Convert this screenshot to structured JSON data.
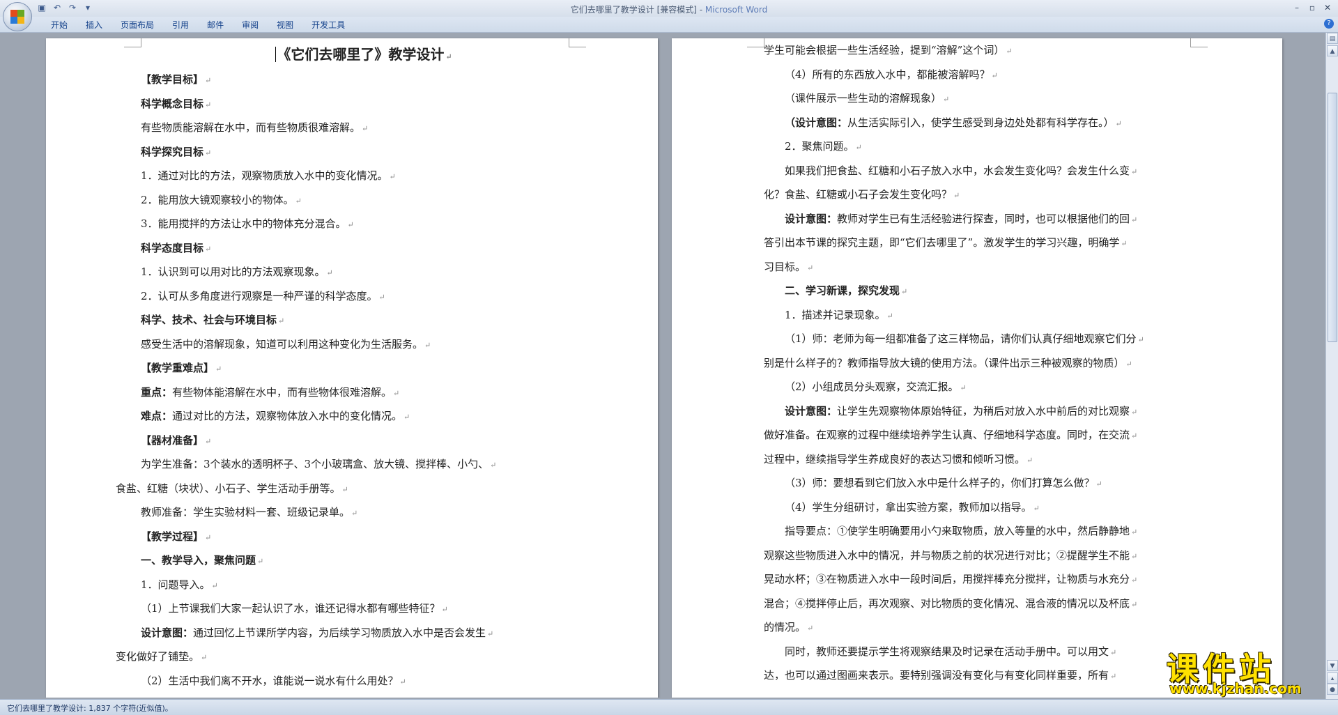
{
  "window": {
    "title": "它们去哪里了教学设计 [兼容模式] - ",
    "app": "Microsoft Word"
  },
  "ribbon": {
    "tabs": [
      "开始",
      "插入",
      "页面布局",
      "引用",
      "邮件",
      "审阅",
      "视图",
      "开发工具"
    ]
  },
  "status": {
    "text": "它们去哪里了教学设计: 1,837 个字符(近似值)。"
  },
  "watermark": {
    "big": "课件站",
    "small": "www.kjzhan.com"
  },
  "left_page": {
    "title": "《它们去哪里了》教学设计",
    "lines": [
      {
        "t": "【教学目标】",
        "b": true
      },
      {
        "t": "科学概念目标",
        "b": true
      },
      {
        "t": "有些物质能溶解在水中，而有些物质很难溶解。"
      },
      {
        "t": "科学探究目标",
        "b": true
      },
      {
        "t": "1．通过对比的方法，观察物质放入水中的变化情况。"
      },
      {
        "t": "2．能用放大镜观察较小的物体。"
      },
      {
        "t": "3．能用搅拌的方法让水中的物体充分混合。"
      },
      {
        "t": "科学态度目标",
        "b": true
      },
      {
        "t": "1．认识到可以用对比的方法观察现象。"
      },
      {
        "t": "2．认可从多角度进行观察是一种严谨的科学态度。"
      },
      {
        "t": "科学、技术、社会与环境目标",
        "b": true
      },
      {
        "t": "感受生活中的溶解现象，知道可以利用这种变化为生活服务。"
      },
      {
        "t": "【教学重难点】",
        "b": true
      },
      {
        "lead": "重点：",
        "t": "有些物体能溶解在水中，而有些物体很难溶解。"
      },
      {
        "lead": "难点：",
        "t": "通过对比的方法，观察物体放入水中的变化情况。"
      },
      {
        "t": "【器材准备】",
        "b": true
      },
      {
        "t": "为学生准备：3个装水的透明杯子、3个小玻璃盒、放大镜、搅拌棒、小勺、"
      },
      {
        "t": "食盐、红糖（块状）、小石子、学生活动手册等。",
        "hang": true
      },
      {
        "t": "教师准备：学生实验材料一套、班级记录单。"
      },
      {
        "t": "【教学过程】",
        "b": true
      },
      {
        "t": "一、教学导入，聚焦问题",
        "b": true
      },
      {
        "t": "1．问题导入。"
      },
      {
        "t": "（1）上节课我们大家一起认识了水，谁还记得水都有哪些特征？"
      },
      {
        "lead": "设计意图：",
        "t": "通过回忆上节课所学内容，为后续学习物质放入水中是否会发生"
      },
      {
        "t": "变化做好了铺垫。",
        "hang": true
      },
      {
        "t": "（2）生活中我们离不开水，谁能说一说水有什么用处？"
      }
    ]
  },
  "right_page": {
    "lines": [
      {
        "t": "学生可能会根据一些生活经验，提到“溶解”这个词）"
      },
      {
        "t": "（4）所有的东西放入水中，都能被溶解吗？",
        "ind": true
      },
      {
        "t": "（课件展示一些生动的溶解现象）",
        "ind": true
      },
      {
        "lead": "（设计意图：",
        "t": "从生活实际引入，使学生感受到身边处处都有科学存在。）",
        "ind": true
      },
      {
        "t": "2．聚焦问题。",
        "ind": true
      },
      {
        "t": "如果我们把食盐、红糖和小石子放入水中，水会发生变化吗？会发生什么变",
        "ind": true
      },
      {
        "t": "化？食盐、红糖或小石子会发生变化吗？"
      },
      {
        "lead": "设计意图：",
        "t": "教师对学生已有生活经验进行探查，同时，也可以根据他们的回",
        "ind": true
      },
      {
        "t": "答引出本节课的探究主题，即“它们去哪里了”。激发学生的学习兴趣，明确学"
      },
      {
        "t": "习目标。"
      },
      {
        "t": "二、学习新课，探究发现",
        "b": true,
        "ind": true
      },
      {
        "t": "1．描述并记录现象。",
        "ind": true
      },
      {
        "t": "（1）师：老师为每一组都准备了这三样物品，请你们认真仔细地观察它们分",
        "ind": true
      },
      {
        "t": "别是什么样子的？教师指导放大镜的使用方法。（课件出示三种被观察的物质）"
      },
      {
        "t": "（2）小组成员分头观察，交流汇报。",
        "ind": true
      },
      {
        "lead": "设计意图：",
        "t": "让学生先观察物体原始特征，为稍后对放入水中前后的对比观察",
        "ind": true
      },
      {
        "t": "做好准备。在观察的过程中继续培养学生认真、仔细地科学态度。同时，在交流"
      },
      {
        "t": "过程中，继续指导学生养成良好的表达习惯和倾听习惯。"
      },
      {
        "t": "（3）师：要想看到它们放入水中是什么样子的，你们打算怎么做？",
        "ind": true
      },
      {
        "t": "（4）学生分组研讨，拿出实验方案，教师加以指导。",
        "ind": true
      },
      {
        "t": "指导要点：①使学生明确要用小勺来取物质，放入等量的水中，然后静静地",
        "ind": true
      },
      {
        "t": "观察这些物质进入水中的情况，并与物质之前的状况进行对比；②提醒学生不能"
      },
      {
        "t": "晃动水杯；③在物质进入水中一段时间后，用搅拌棒充分搅拌，让物质与水充分"
      },
      {
        "t": "混合；④搅拌停止后，再次观察、对比物质的变化情况、混合液的情况以及杯底"
      },
      {
        "t": "的情况。"
      },
      {
        "t": "同时，教师还要提示学生将观察结果及时记录在活动手册中。可以用文",
        "ind": true
      },
      {
        "t": "达，也可以通过图画来表示。要特别强调没有变化与有变化同样重要，所有"
      }
    ]
  }
}
